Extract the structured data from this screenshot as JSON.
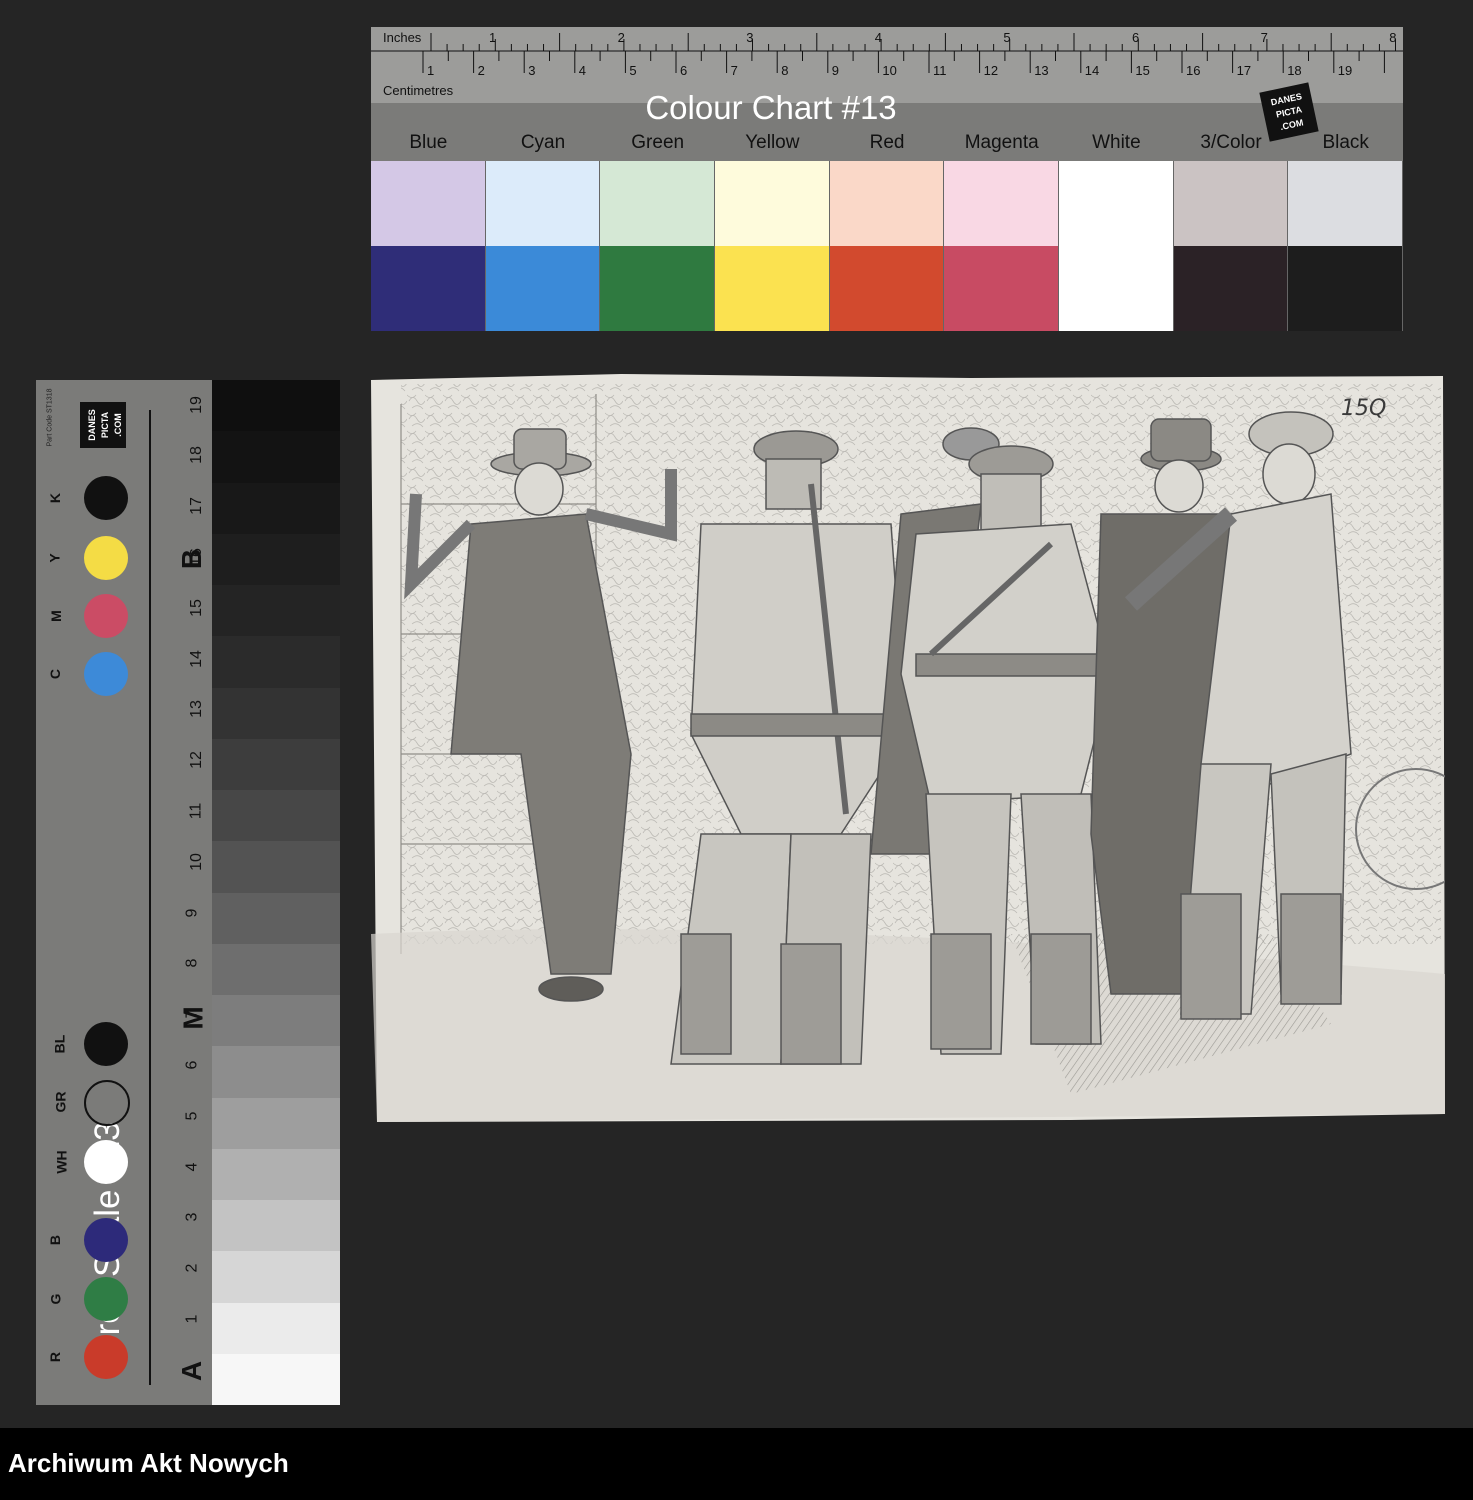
{
  "colour_chart": {
    "title": "Colour Chart #13",
    "inches_label": "Inches",
    "centimetres_label": "Centimetres",
    "inch_marks": [
      "1",
      "2",
      "3",
      "4",
      "5",
      "6",
      "7",
      "8"
    ],
    "cm_marks": [
      "1",
      "2",
      "3",
      "4",
      "5",
      "6",
      "7",
      "8",
      "9",
      "10",
      "11",
      "12",
      "13",
      "14",
      "15",
      "16",
      "17",
      "18",
      "19"
    ],
    "patch_labels": [
      "Blue",
      "Cyan",
      "Green",
      "Yellow",
      "Red",
      "Magenta",
      "White",
      "3/Color",
      "Black"
    ],
    "light_colors": [
      "#d4c8e6",
      "#dcebfa",
      "#d5e8d5",
      "#fefbdc",
      "#fad8c8",
      "#f9d8e4",
      "#ffffff",
      "#cbc3c3",
      "#dcdde1"
    ],
    "dark_colors": [
      "#2f2d78",
      "#3b8ad8",
      "#2f7a40",
      "#fbe250",
      "#d24a2e",
      "#c84b63",
      "#ffffff",
      "#2b2226",
      "#1d1d1d"
    ],
    "logo_text": "DANES-PICTA.COM"
  },
  "grey_scale": {
    "title": "Grey Scale #13",
    "part_code": "Part Code ST1318",
    "logo_text": "DANES-PICTA.COM",
    "numbers": [
      "1",
      "2",
      "3",
      "4",
      "5",
      "6",
      "7",
      "8",
      "9",
      "10",
      "11",
      "12",
      "13",
      "14",
      "15",
      "16",
      "17",
      "18",
      "19"
    ],
    "letters": [
      "A",
      "M",
      "B"
    ],
    "patch_labels": [
      "R",
      "G",
      "B",
      "WH",
      "GR",
      "BL",
      "C",
      "M",
      "Y",
      "K"
    ],
    "patch_colors": [
      "#c93b2a",
      "#2f7d45",
      "#2d2a7a",
      "#ffffff",
      "#777777",
      "#111111",
      "#3d8ad8",
      "#cb4c65",
      "#f4dc45",
      "#111111"
    ],
    "ramp_colors": [
      "#f7f7f7",
      "#ebebeb",
      "#d6d6d6",
      "#c3c3c3",
      "#b0b0b0",
      "#9e9e9e",
      "#8d8d8d",
      "#7d7d7d",
      "#6e6e6e",
      "#606060",
      "#535353",
      "#474747",
      "#3d3d3d",
      "#333333",
      "#2b2b2b",
      "#242424",
      "#1e1e1e",
      "#181818",
      "#131313",
      "#0f0f0f"
    ]
  },
  "drawing": {
    "page_number": "15Q",
    "paper_color": "#e8e6e0"
  },
  "footer": {
    "text": "Archiwum Akt Nowych"
  }
}
